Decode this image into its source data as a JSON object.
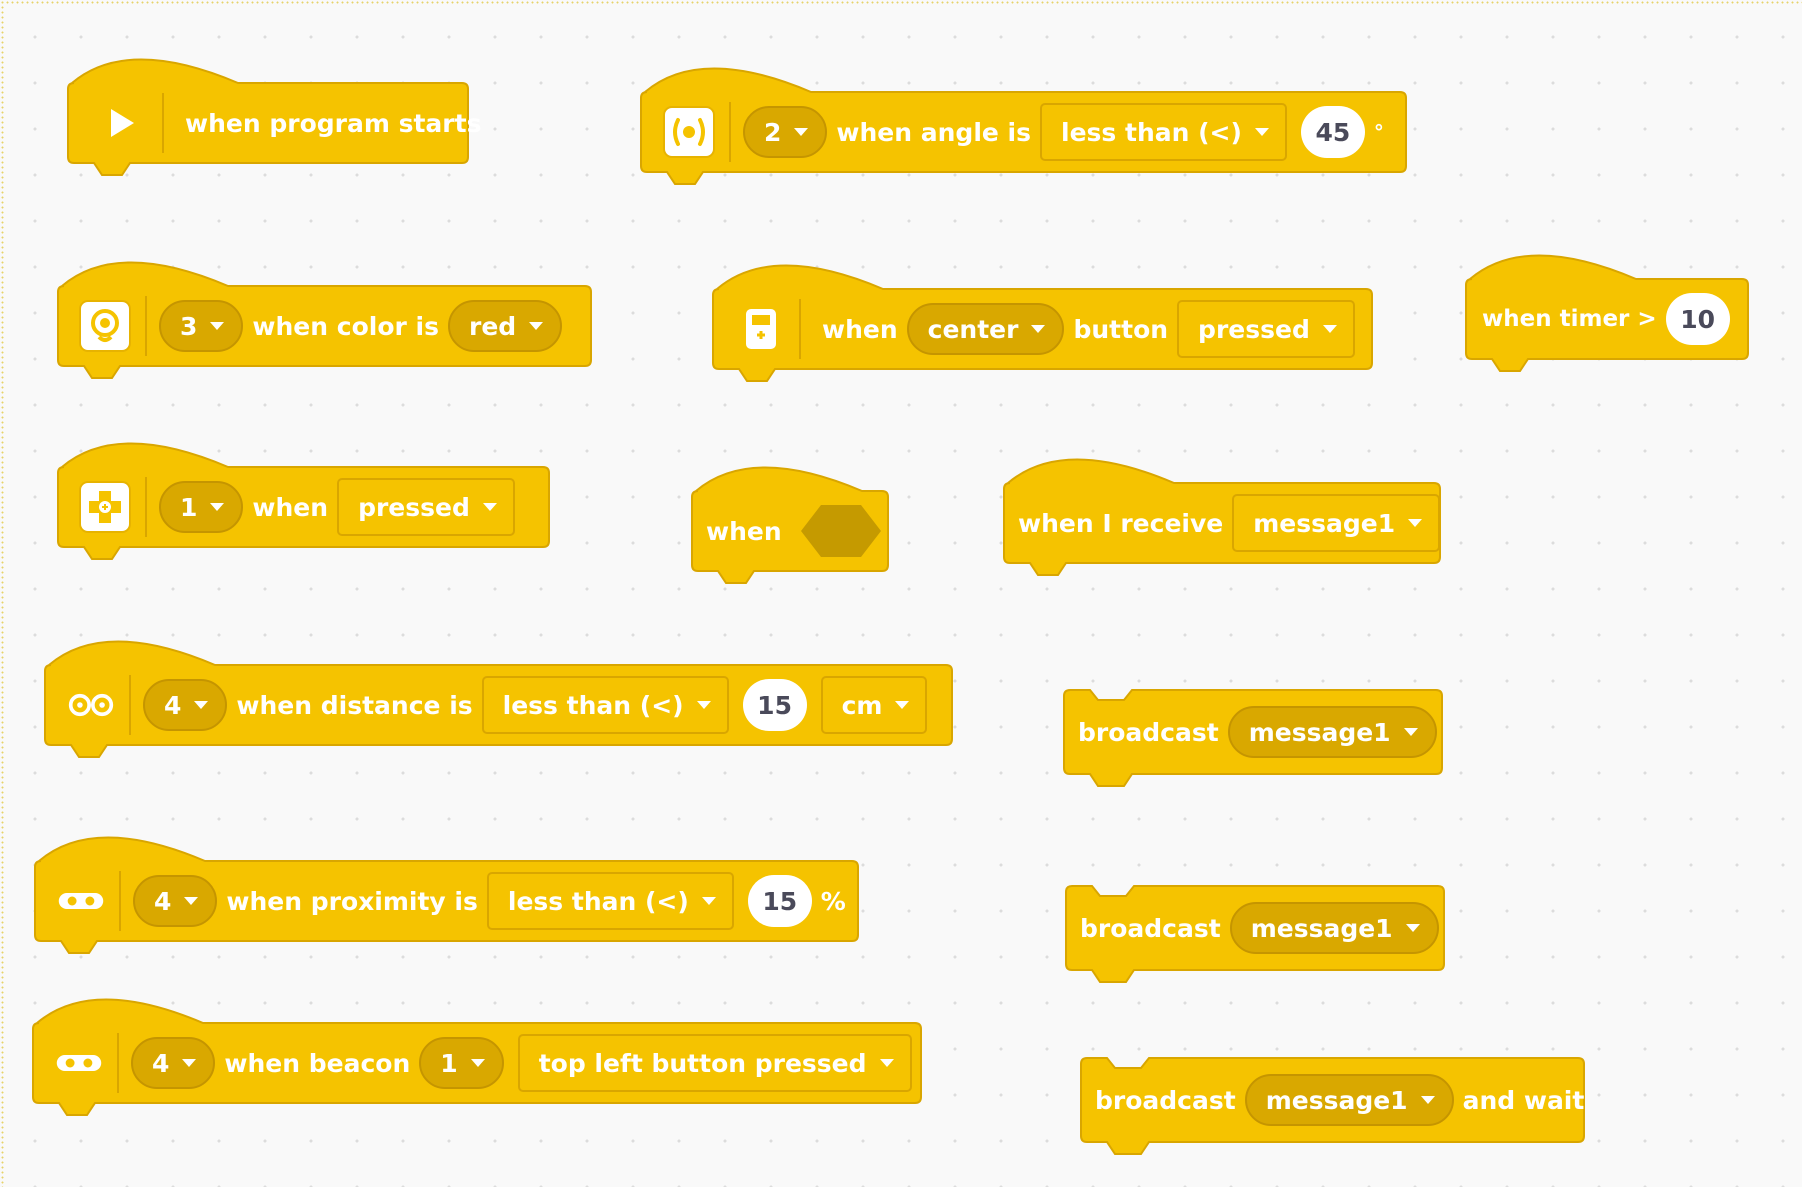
{
  "colors": {
    "block_fill": "#f5c300",
    "block_stroke": "#d9a600",
    "field_dark": "#d9a800",
    "canvas": "#f9f9f9",
    "icon_stroke": "#e7b300"
  },
  "blocks": {
    "program_start": {
      "icon": "play-icon",
      "label": "when program starts"
    },
    "angle": {
      "icon": "gyro-sensor-icon",
      "port": "2",
      "label": "when angle is",
      "comparator": "less than (<)",
      "value": "45",
      "unit": "°"
    },
    "color": {
      "icon": "color-sensor-icon",
      "port": "3",
      "label": "when color is",
      "color_value": "red"
    },
    "brick_button": {
      "icon": "brick-button-icon",
      "label_when": "when",
      "button": "center",
      "label_button": "button",
      "state": "pressed"
    },
    "timer": {
      "label": "when timer >",
      "value": "10"
    },
    "touch": {
      "icon": "touch-sensor-icon",
      "port": "1",
      "label": "when",
      "state": "pressed"
    },
    "when_condition": {
      "label": "when"
    },
    "receive": {
      "label": "when I receive",
      "message": "message1"
    },
    "distance": {
      "icon": "ultrasonic-sensor-icon",
      "port": "4",
      "label": "when distance is",
      "comparator": "less than (<)",
      "value": "15",
      "unit": "cm"
    },
    "broadcast1": {
      "label": "broadcast",
      "message": "message1"
    },
    "proximity": {
      "icon": "infrared-sensor-icon",
      "port": "4",
      "label": "when proximity is",
      "comparator": "less than (<)",
      "value": "15",
      "unit": "%"
    },
    "broadcast2": {
      "label": "broadcast",
      "message": "message1"
    },
    "beacon": {
      "icon": "infrared-sensor-icon",
      "port": "4",
      "label": "when beacon",
      "channel": "1",
      "button": "top left button pressed"
    },
    "broadcast_wait": {
      "label": "broadcast",
      "message": "message1",
      "label_end": "and wait"
    }
  }
}
